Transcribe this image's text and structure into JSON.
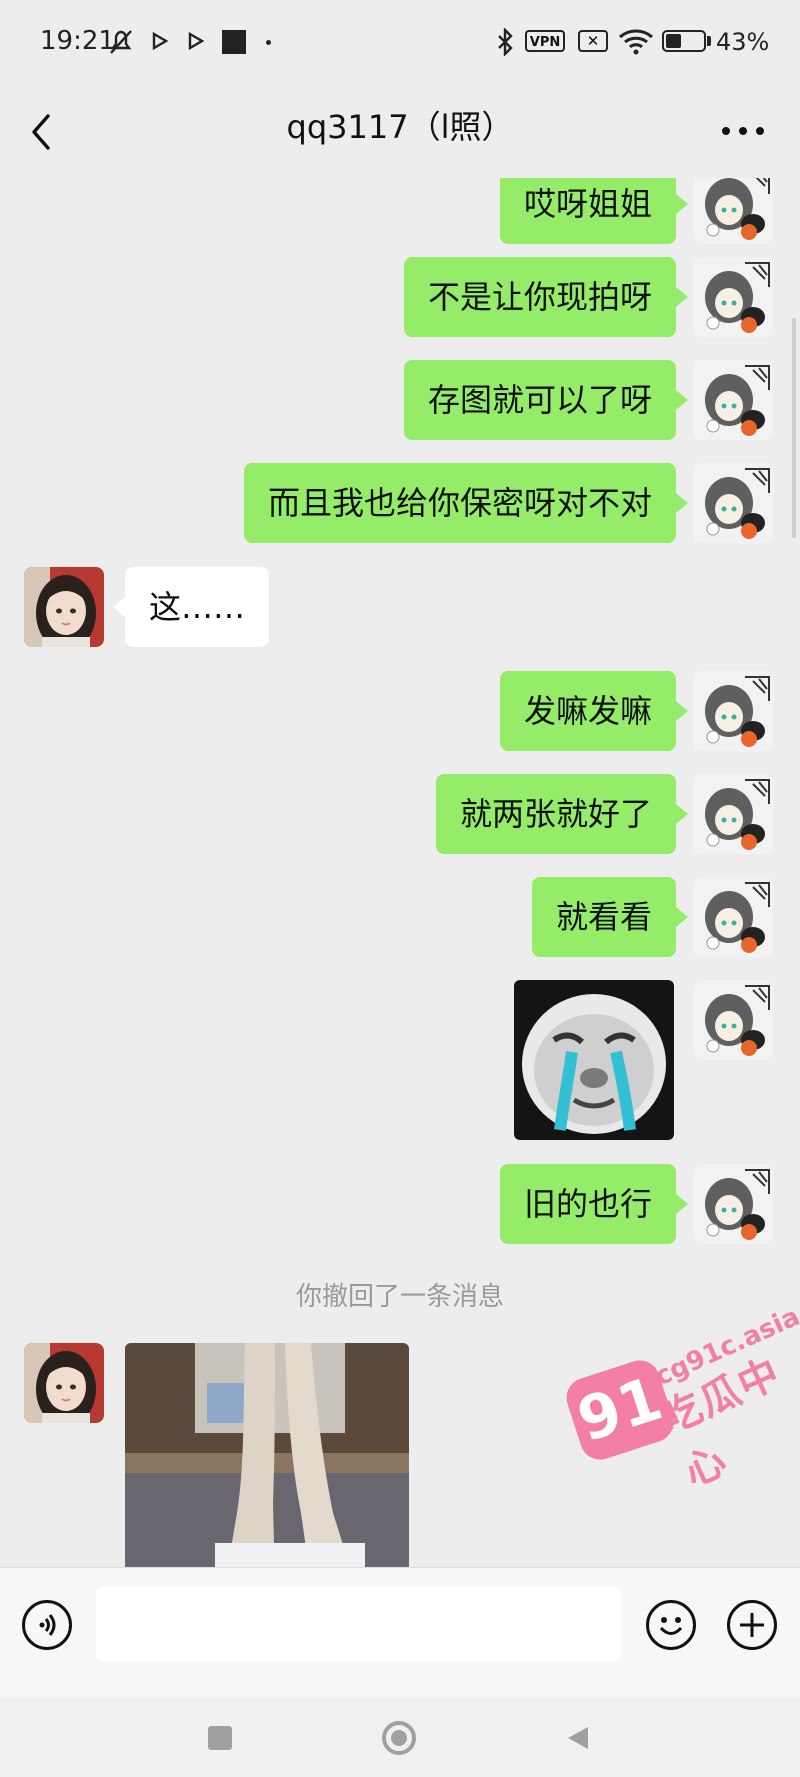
{
  "status_bar": {
    "time": "19:21",
    "vpn": "VPN",
    "sim_icon": "sim-no-signal-icon",
    "battery_percent": 43,
    "battery_label": "43%"
  },
  "header": {
    "title": "qq3117（l照）",
    "back_icon": "chevron-left-icon",
    "more_icon": "more-dots-icon"
  },
  "messages": [
    {
      "side": "right",
      "type": "text",
      "text": "哎呀姐姐"
    },
    {
      "side": "right",
      "type": "text",
      "text": "不是让你现拍呀"
    },
    {
      "side": "right",
      "type": "text",
      "text": "存图就可以了呀"
    },
    {
      "side": "right",
      "type": "text",
      "text": "而且我也给你保密呀对不对"
    },
    {
      "side": "left",
      "type": "text",
      "text": "这……"
    },
    {
      "side": "right",
      "type": "text",
      "text": "发嘛发嘛"
    },
    {
      "side": "right",
      "type": "text",
      "text": "就两张就好了"
    },
    {
      "side": "right",
      "type": "text",
      "text": "就看看"
    },
    {
      "side": "right",
      "type": "sticker",
      "sticker": "crying-face-sticker"
    },
    {
      "side": "right",
      "type": "text",
      "text": "旧的也行"
    },
    {
      "side": "system",
      "type": "notice",
      "text": "你撤回了一条消息"
    },
    {
      "side": "left",
      "type": "image",
      "image": "photo-legs"
    }
  ],
  "watermark": {
    "badge": "91",
    "url": "cg91c.asia",
    "name": "吃瓜中心"
  },
  "input_bar": {
    "voice_icon": "voice-icon",
    "text_value": "",
    "emoji_icon": "emoji-icon",
    "add_icon": "plus-icon"
  },
  "nav_bar": {
    "recents_icon": "square-icon",
    "home_icon": "circle-icon",
    "back_icon": "triangle-back-icon"
  }
}
